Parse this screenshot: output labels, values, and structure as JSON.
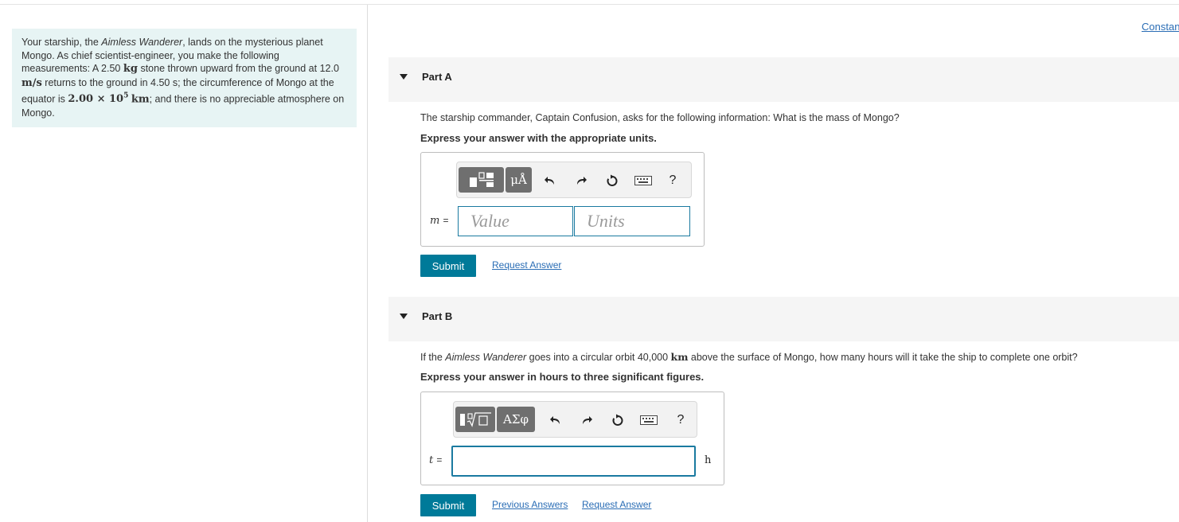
{
  "intro": {
    "seg1": "Your starship, the ",
    "ship_name": "Aimless Wanderer",
    "seg2": ", lands on the mysterious planet Mongo. As chief scientist-engineer, you make the following measurements: A 2.50 ",
    "unit_kg": "kg",
    "seg3": " stone thrown upward from the ground at 12.0 ",
    "unit_ms": "m/s",
    "seg4": " returns to the ground in 4.50 s; the circumference of Mongo at the equator is ",
    "circumference": "2.00 × 10",
    "circumference_exp": "5",
    "unit_km": "km",
    "seg5": "; and there is no appreciable atmosphere on Mongo."
  },
  "constants_link": "Constan",
  "part_a": {
    "title": "Part A",
    "question": "The starship commander, Captain Confusion, asks for the following information: What is the mass of Mongo?",
    "instruction": "Express your answer with the appropriate units.",
    "toolbar": {
      "unit_symbol": "μÅ",
      "help": "?"
    },
    "variable": "m",
    "equals": "=",
    "value_placeholder": "Value",
    "units_placeholder": "Units",
    "submit": "Submit",
    "request_answer": "Request Answer"
  },
  "part_b": {
    "title": "Part B",
    "q_seg1": "If the ",
    "q_ship": "Aimless Wanderer",
    "q_seg2": " goes into a circular orbit 40,000 ",
    "q_unit": "km",
    "q_seg3": " above the surface of Mongo, how many hours will it take the ship to complete one orbit?",
    "instruction": "Express your answer in hours to three significant figures.",
    "toolbar": {
      "greek": "ΑΣφ",
      "help": "?"
    },
    "variable": "t",
    "equals": "=",
    "unit": "h",
    "submit": "Submit",
    "previous_answers": "Previous Answers",
    "request_answer": "Request Answer"
  }
}
